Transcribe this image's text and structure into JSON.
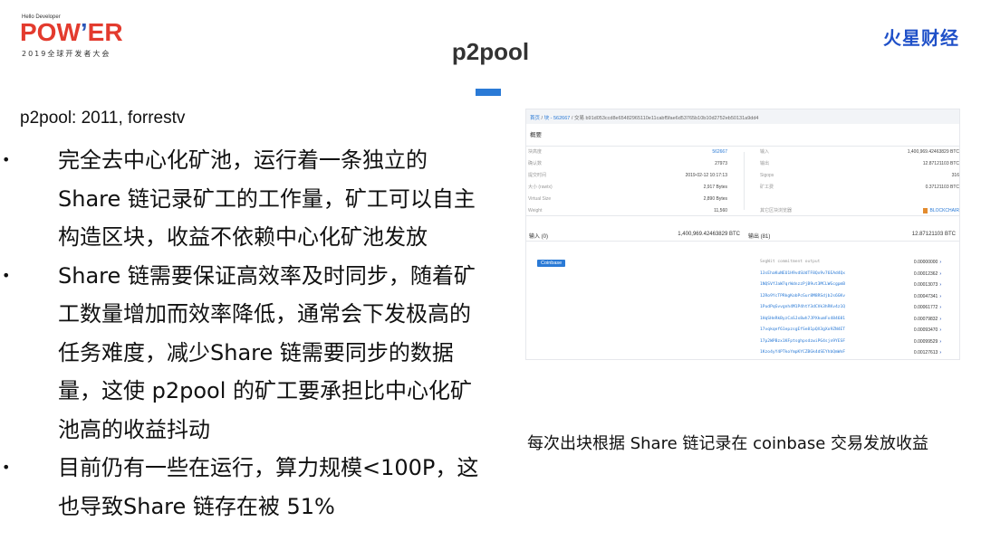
{
  "logos": {
    "left_small": "Hello Developer",
    "left_main_1": "POW",
    "left_main_apos": "’",
    "left_main_2": "ER",
    "left_sub": "2019全球开发者大会",
    "right": "火星财经"
  },
  "slide_title": "p2pool",
  "subtitle": "p2pool: 2011, forrestv",
  "bullets": [
    {
      "marker": "•",
      "text": "完全去中心化矿池，运行着一条独立的Share 链记录矿工的工作量，矿工可以自主构造区块，收益不依赖中心化矿池发放"
    },
    {
      "marker": "•",
      "text": "Share 链需要保证高效率及时同步，随着矿工数量增加而效率降低，通常会下发极高的任务难度，减少Share 链需要同步的数据量，这使 p2pool 的矿工要承担比中心化矿池高的收益抖动"
    },
    {
      "marker": "•",
      "text": "目前仍有一些在运行，算力规模<100P，这也导致Share 链存在被 51%"
    }
  ],
  "explorer": {
    "breadcrumb_home": "首页",
    "breadcrumb_block": "块 - 562667",
    "breadcrumb_tx": "交易 b91d053ccd8e65482965110e11cabf5fae6d53765b10b10d2752eb50131a9dd4",
    "section": "概要",
    "left_rows": [
      {
        "label": "块高度",
        "value": "562667",
        "blue": true
      },
      {
        "label": "确认数",
        "value": "27973",
        "blue": false
      },
      {
        "label": "提交时间",
        "value": "2019-02-12 10:17:13",
        "blue": false
      },
      {
        "label": "大小 (rawtx)",
        "value": "2,917 Bytes",
        "blue": false
      },
      {
        "label": "Virtual Size",
        "value": "2,890 Bytes",
        "blue": false
      },
      {
        "label": "Weight",
        "value": "11,560",
        "blue": false
      }
    ],
    "right_rows": [
      {
        "label": "输入",
        "value": "1,400,969.42463829 BTC"
      },
      {
        "label": "输出",
        "value": "12.87121103 BTC"
      },
      {
        "label": "Sigops",
        "value": "316"
      },
      {
        "label": "矿工费",
        "value": "0.37121103 BTC"
      },
      {
        "label": "",
        "value": ""
      },
      {
        "label": "其它区块浏览器",
        "value": "BLOCKCHAIR"
      }
    ],
    "inputs_label": "输入 (0)",
    "inputs_value": "1,400,969.42463829 BTC",
    "outputs_label": "输出 (81)",
    "outputs_value": "12.87121103 BTC",
    "coinbase": "Coinbase",
    "outputs": [
      {
        "addr": "SegWit commitment output",
        "amount": "0.00000000"
      },
      {
        "addr": "13sEhaKuNEU1H9vdSUdTF8Qx9v76EAd4Qx",
        "amount": "0.00012362"
      },
      {
        "addr": "1NQSVfJaW7qrWdnzzPjB9ut3MCLWGcgpmB",
        "amount": "0.00013073"
      },
      {
        "addr": "12Ro9YcTPRkgKobPcGur8M8RSdjb2s6GKv",
        "amount": "0.00047341"
      },
      {
        "addr": "1PudPqGvvgnh4M1P4htY3dCVk3hRKv4z1Q",
        "amount": "0.00061772"
      },
      {
        "addr": "1HqSHeRkByzCaSJx8wh7JPXkumFx484681",
        "amount": "0.00079832"
      },
      {
        "addr": "17vqkqef61epzsgEfSe81pQX3gXo9ZN4ET",
        "amount": "0.00093470"
      },
      {
        "addr": "17p2WPBzx1KFptsghpsdzwiPG4sjn9YESF",
        "amount": "0.00099529"
      },
      {
        "addr": "1Kzo4yY4PTkoYmpKYCZBGk4dSEYhbQmWnF",
        "amount": "0.00127613"
      }
    ]
  },
  "caption": "每次出块根据 Share 链记录在 coinbase 交易发放收益",
  "colors": {
    "accent": "#2a7ad6",
    "logo_red": "#e33b2e",
    "logo_blue": "#2a55b8",
    "brand_right": "#1f50c8"
  }
}
